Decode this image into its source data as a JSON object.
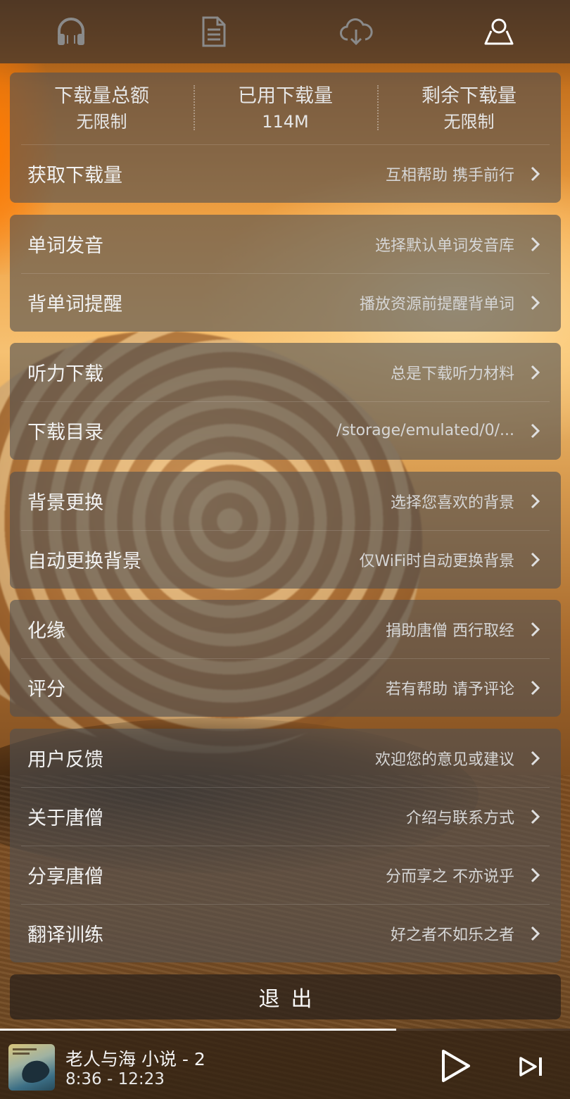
{
  "tabs": [
    {
      "icon": "headphones-icon"
    },
    {
      "icon": "document-icon"
    },
    {
      "icon": "cloud-download-icon"
    },
    {
      "icon": "user-icon",
      "active": true
    }
  ],
  "quota": {
    "total_label": "下载量总额",
    "total_value": "无限制",
    "used_label": "已用下载量",
    "used_value": "114M",
    "remaining_label": "剩余下载量",
    "remaining_value": "无限制",
    "get_more": {
      "title": "获取下载量",
      "hint": "互相帮助 携手前行"
    }
  },
  "groups": [
    {
      "items": [
        {
          "title": "单词发音",
          "hint": "选择默认单词发音库"
        },
        {
          "title": "背单词提醒",
          "hint": "播放资源前提醒背单词"
        }
      ]
    },
    {
      "items": [
        {
          "title": "听力下载",
          "hint": "总是下载听力材料"
        },
        {
          "title": "下载目录",
          "hint": "/storage/emulated/0/..."
        }
      ]
    },
    {
      "items": [
        {
          "title": "背景更换",
          "hint": "选择您喜欢的背景"
        },
        {
          "title": "自动更换背景",
          "hint": "仅WiFi时自动更换背景"
        }
      ]
    },
    {
      "items": [
        {
          "title": "化缘",
          "hint": "捐助唐僧 西行取经"
        },
        {
          "title": "评分",
          "hint": "若有帮助 请予评论"
        }
      ]
    },
    {
      "items": [
        {
          "title": "用户反馈",
          "hint": "欢迎您的意见或建议"
        },
        {
          "title": "关于唐僧",
          "hint": "介绍与联系方式"
        },
        {
          "title": "分享唐僧",
          "hint": "分而享之 不亦说乎"
        },
        {
          "title": "翻译训练",
          "hint": "好之者不如乐之者"
        }
      ]
    }
  ],
  "logout_label": "退出",
  "player": {
    "title": "老人与海 小说 - 2",
    "time": "8:36 - 12:23",
    "progress_fraction": 0.695
  },
  "colors": {
    "accent": "#ffffff",
    "card_bg": "rgba(80,80,82,0.62)"
  }
}
